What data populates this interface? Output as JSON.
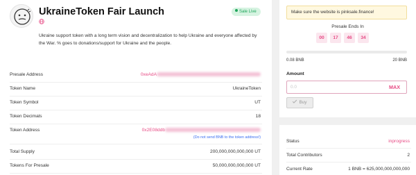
{
  "header": {
    "title": "UkraineToken Fair Launch",
    "status_badge": "Sale Live",
    "description": "Ukraine support token with a long term vision and decentralization to help Ukraine and everyone affected by the War. % goes to donations/support for Ukraine and the people."
  },
  "details": [
    {
      "label": "Presale Address",
      "value": "0xeAdA",
      "link": true
    },
    {
      "label": "Token Name",
      "value": "UkraineToken"
    },
    {
      "label": "Token Symbol",
      "value": "UT"
    },
    {
      "label": "Token Decimals",
      "value": "18"
    },
    {
      "label": "Token Address",
      "value": "0x2E08ddb",
      "link": true,
      "warning": "(Do not send BNB to the token address!)"
    },
    {
      "label": "Total Supply",
      "value": "200,000,000,000,000 UT"
    },
    {
      "label": "Tokens For Presale",
      "value": "50,000,000,000,000 UT"
    }
  ],
  "sale_panel": {
    "notice": "Make sure the website is pinksale.finance!",
    "presale_ends_label": "Presale Ends In",
    "countdown": [
      "00",
      "17",
      "46",
      "34"
    ],
    "progress_fraction": 0.0,
    "min_label": "0.08 BNB",
    "max_label": "20 BNB",
    "amount_label": "Amount",
    "amount_placeholder": "0.0",
    "max_button": "MAX",
    "buy_button": "Buy"
  },
  "stats": [
    {
      "label": "Status",
      "value": "inprogress",
      "accent": true
    },
    {
      "label": "Total Contributors",
      "value": "2"
    },
    {
      "label": "Current Rate",
      "value": "1 BNB = 625,000,000,000,000"
    }
  ],
  "colors": {
    "accent": "#e74a84",
    "live": "#1ea55a",
    "info": "#3a6df0"
  }
}
